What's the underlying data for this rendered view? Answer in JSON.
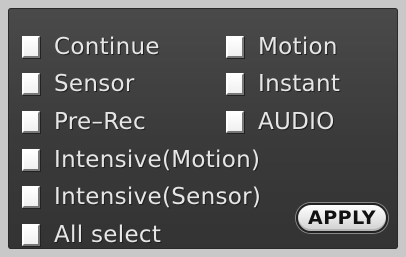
{
  "options": {
    "continue": "Continue",
    "motion": "Motion",
    "sensor": "Sensor",
    "instant": "Instant",
    "pre_rec": "Pre–Rec",
    "audio": "AUDIO",
    "intensive_motion": "Intensive(Motion)",
    "intensive_sensor": "Intensive(Sensor)",
    "all_select": "All select"
  },
  "apply_label": "APPLY"
}
